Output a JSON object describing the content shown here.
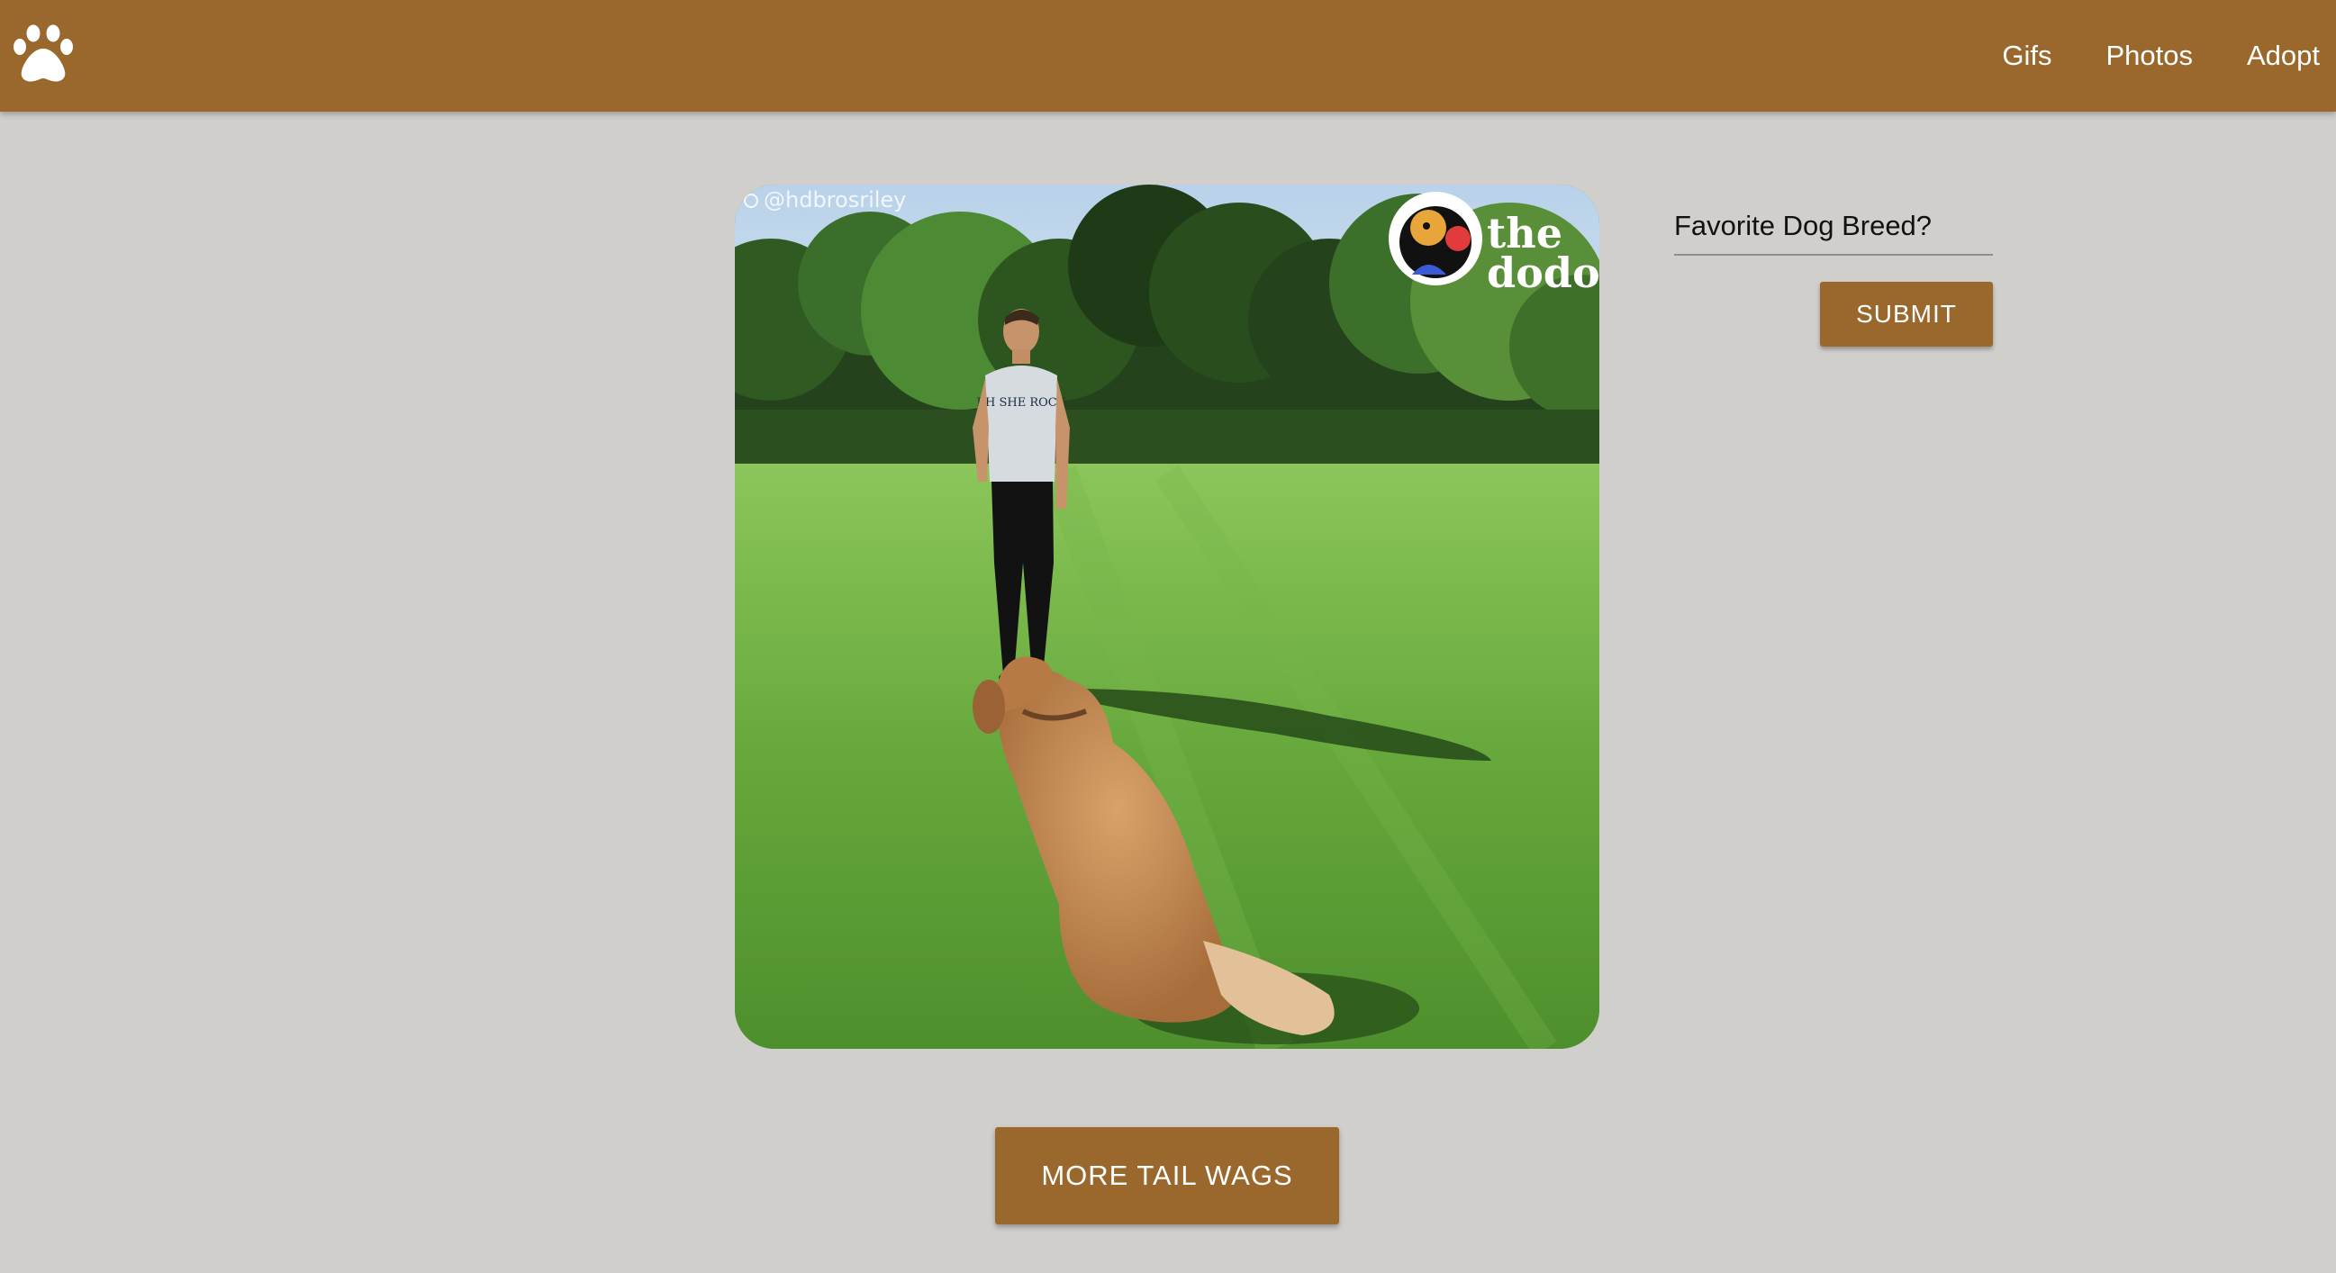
{
  "navbar": {
    "logo_icon": "paw-icon",
    "links": [
      {
        "label": "Gifs"
      },
      {
        "label": "Photos"
      },
      {
        "label": "Adopt"
      }
    ]
  },
  "media": {
    "watermark_handle": "@hdbrosriley",
    "brand_badge_line1": "the",
    "brand_badge_line2": "dodo",
    "shirt_text": "EH SHE ROCK"
  },
  "breed_form": {
    "placeholder": "Favorite Dog Breed?",
    "value": "",
    "submit_label": "SUBMIT"
  },
  "more_button": {
    "label": "MORE TAIL WAGS"
  },
  "colors": {
    "accent": "#9a682c",
    "background": "#d1cfcb",
    "text_on_accent": "#ffffff"
  }
}
